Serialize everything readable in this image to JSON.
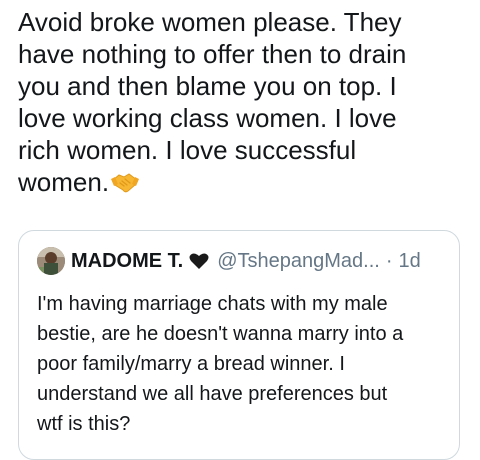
{
  "tweet": {
    "text_lines": [
      "Avoid broke women please. They",
      "have nothing to offer then to drain",
      "you and then blame you on top. I",
      "love working class women. I love",
      "rich women. I love successful",
      "women."
    ],
    "emoji": "handshake-icon"
  },
  "quoted_tweet": {
    "author_name": "MADOME T.",
    "verified_emoji": "black-heart-icon",
    "handle": "@TshepangMad...",
    "separator": "·",
    "time": "1d",
    "text_lines": [
      "I'm having marriage chats with my male",
      "bestie, are he doesn't wanna marry into a",
      "poor family/marry a bread winner. I",
      "understand we all have preferences but",
      "wtf is this?"
    ]
  },
  "colors": {
    "text": "#14171a",
    "secondary_text": "#657786",
    "card_border": "#cfd9de",
    "emoji_yellow": "#f7b733"
  }
}
